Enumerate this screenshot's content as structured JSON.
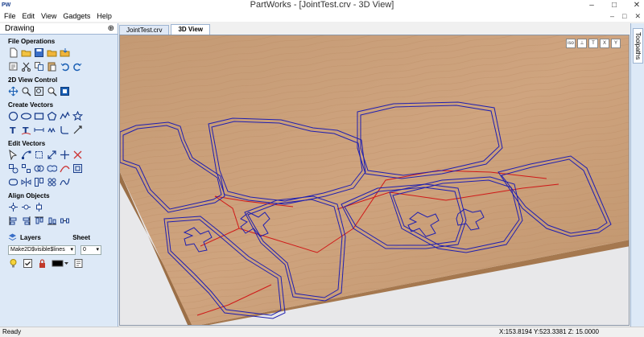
{
  "window": {
    "app_icon": "PW",
    "title": "PartWorks - [JointTest.crv - 3D View]",
    "controls": [
      "–",
      "□",
      "✕"
    ]
  },
  "menu": {
    "items": [
      "File",
      "Edit",
      "View",
      "Gadgets",
      "Help"
    ],
    "right_controls": [
      "–",
      "□",
      "✕"
    ]
  },
  "panel": {
    "title": "Drawing",
    "pin": "⊕",
    "sections": {
      "file_operations": "File Operations",
      "view_control": "2D View Control",
      "create_vectors": "Create Vectors",
      "edit_vectors": "Edit Vectors",
      "align_objects": "Align Objects"
    },
    "layers_label": "Layers",
    "sheet_label": "Sheet",
    "layer_value": "Make2D$visible$lines",
    "sheet_value": "0"
  },
  "tabs": [
    "JointTest.crv",
    "3D View"
  ],
  "active_tab": 1,
  "right_strip": {
    "tab": "Toolpaths"
  },
  "view_toolbar": [
    "iso",
    "⊥",
    "T",
    "X",
    "Y"
  ],
  "status": {
    "left": "Ready",
    "coords": "X:153.8194 Y:523.3381 Z: 15.0000"
  },
  "colors": {
    "wood": "#c89c77",
    "vector": "#1f1fb0",
    "toolpath_red": "#d01818"
  }
}
